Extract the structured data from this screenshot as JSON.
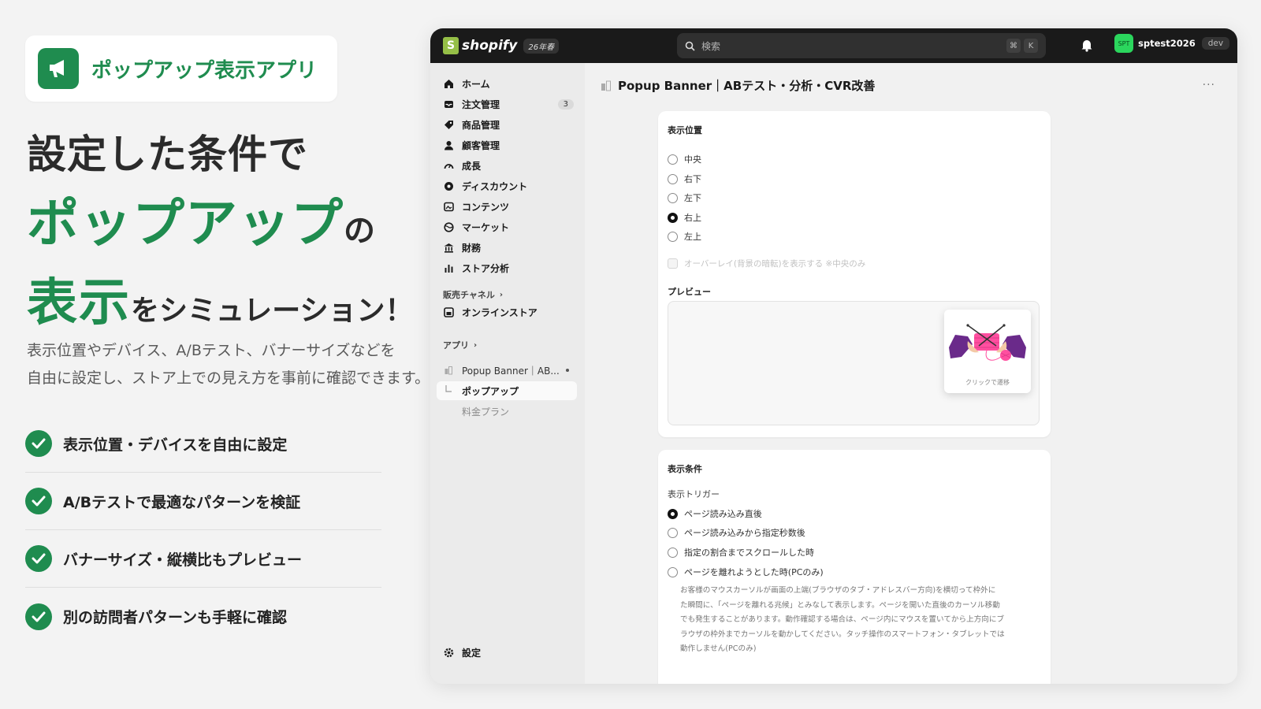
{
  "promo": {
    "app_name": "ポップアップ表示アプリ",
    "headline_line1": "設定した条件で",
    "headline_line2_big": "ポップアップ",
    "headline_line2_small": "の",
    "headline_line3_big": "表示",
    "headline_line3_small": "をシミュレーション！",
    "description_line1": "表示位置やデバイス、A/Bテスト、バナーサイズなどを",
    "description_line2": "自由に設定し、ストア上での見え方を事前に確認できます。",
    "features": [
      "表示位置・デバイスを自由に設定",
      "A/Bテストで最適なパターンを検証",
      "バナーサイズ・縦横比もプレビュー",
      "別の訪問者パターンも手軽に確認"
    ],
    "accent_color": "#1f8c4f"
  },
  "topbar": {
    "brand": "shopify",
    "version": "26年春",
    "search_placeholder": "検索",
    "shortcut_keys": [
      "⌘",
      "K"
    ],
    "avatar_initials": "SPT",
    "store_name": "sptest2026",
    "env_badge": "dev"
  },
  "sidebar": {
    "items": [
      {
        "label": "ホーム",
        "icon": "home-icon"
      },
      {
        "label": "注文管理",
        "icon": "inbox-icon",
        "badge": "3"
      },
      {
        "label": "商品管理",
        "icon": "tag-icon"
      },
      {
        "label": "顧客管理",
        "icon": "person-icon"
      },
      {
        "label": "成長",
        "icon": "gauge-icon"
      },
      {
        "label": "ディスカウント",
        "icon": "gear-badge-icon"
      },
      {
        "label": "コンテンツ",
        "icon": "content-icon"
      },
      {
        "label": "マーケット",
        "icon": "globe-icon"
      },
      {
        "label": "財務",
        "icon": "bank-icon"
      },
      {
        "label": "ストア分析",
        "icon": "bar-chart-icon"
      }
    ],
    "sales_channels_label": "販売チャネル",
    "online_store_label": "オンラインストア",
    "apps_label": "アプリ",
    "app_item_label": "Popup Banner｜AB...",
    "app_sub_active": "ポップアップ",
    "app_sub_plan": "料金プラン",
    "settings_label": "設定"
  },
  "page": {
    "title": "Popup Banner｜ABテスト・分析・CVR改善",
    "more": "···"
  },
  "position_card": {
    "title": "表示位置",
    "options": [
      "中央",
      "右下",
      "左下",
      "右上",
      "左上"
    ],
    "selected_index": 3,
    "overlay_label": "オーバーレイ(背景の暗転)を表示する ※中央のみ",
    "preview_label": "プレビュー",
    "popup_caption": "クリックで遷移"
  },
  "condition_card": {
    "title": "表示条件",
    "trigger_label": "表示トリガー",
    "options": [
      "ページ読み込み直後",
      "ページ読み込みから指定秒数後",
      "指定の割合までスクロールした時",
      "ページを離れようとした時(PCのみ)"
    ],
    "selected_index": 0,
    "help_lines": [
      "お客様のマウスカーソルが画面の上端(ブラウザのタブ・アドレスバー方向)を横切って枠外に",
      "た瞬間に、「ページを離れる兆候」とみなして表示します。ページを開いた直後のカーソル移動",
      "でも発生することがあります。動作確認する場合は、ページ内にマウスを置いてから上方向にブ",
      "ラウザの枠外までカーソルを動かしてください。タッチ操作のスマートフォン・タブレットでは",
      "動作しません(PCのみ)"
    ]
  }
}
